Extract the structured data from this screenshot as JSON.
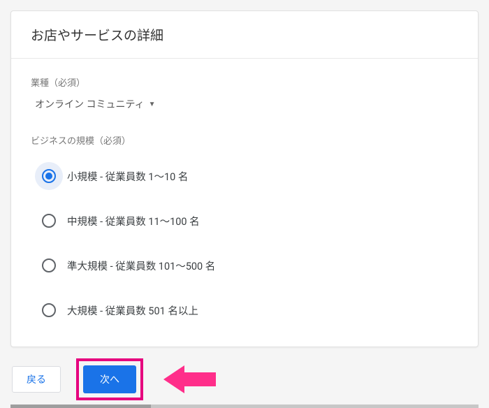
{
  "header": {
    "title": "お店やサービスの詳細"
  },
  "industry": {
    "label": "業種（必須）",
    "value": "オンライン コミュニティ"
  },
  "businessSize": {
    "label": "ビジネスの規模（必須）",
    "options": [
      "小規模 - 従業員数 1～10 名",
      "中規模 - 従業員数 11～100 名",
      "準大規模 - 従業員数 101～500 名",
      "大規模 - 従業員数 501 名以上"
    ],
    "selectedIndex": 0
  },
  "footer": {
    "back": "戻る",
    "next": "次へ"
  },
  "callout": {
    "arrowColor": "#ff2e8a"
  }
}
